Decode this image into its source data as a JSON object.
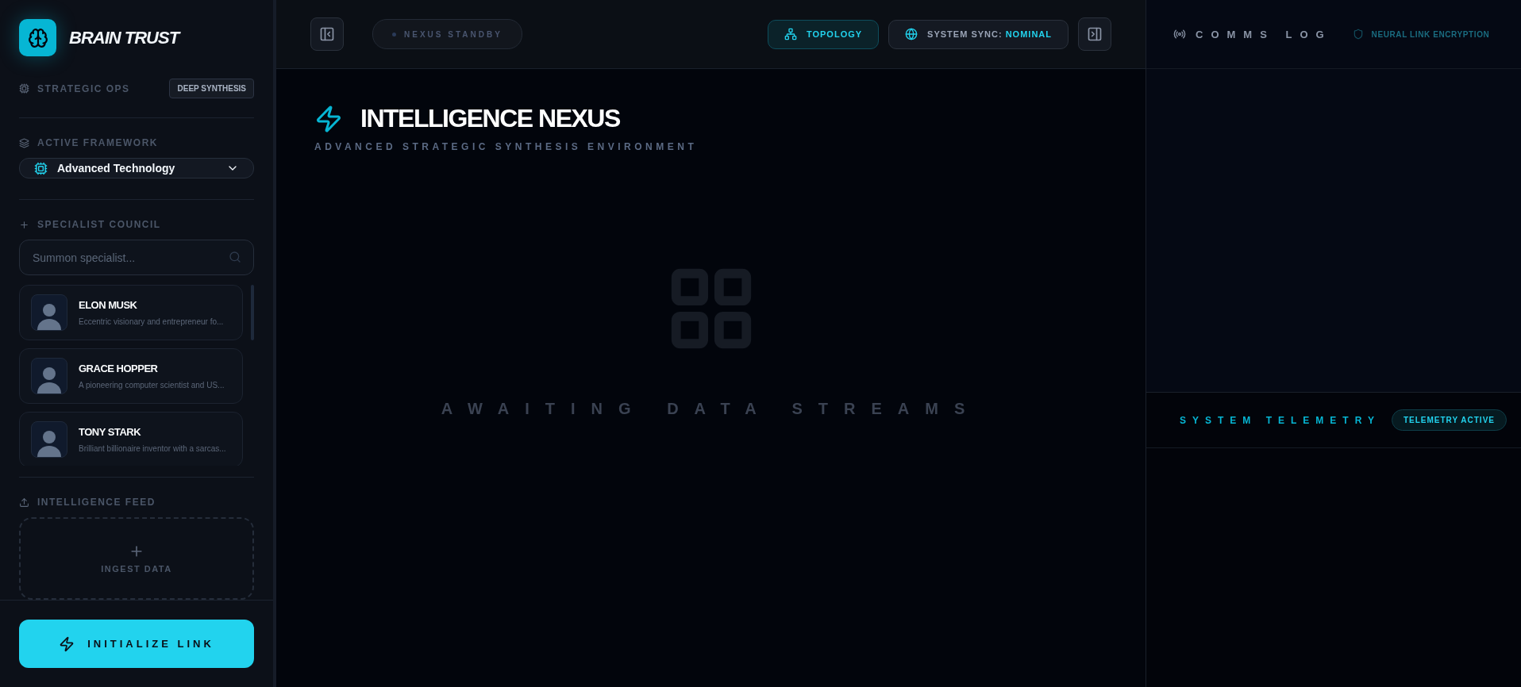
{
  "brand": {
    "name": "BRAIN TRUST"
  },
  "sidebar": {
    "ops": {
      "label": "STRATEGIC OPS",
      "badge": "DEEP SYNTHESIS"
    },
    "framework": {
      "label": "ACTIVE FRAMEWORK",
      "value": "Advanced Technology"
    },
    "council": {
      "label": "SPECIALIST COUNCIL",
      "search_placeholder": "Summon specialist...",
      "specialists": [
        {
          "name": "ELON MUSK",
          "description": "Eccentric visionary and entrepreneur fo...",
          "selected": false
        },
        {
          "name": "GRACE HOPPER",
          "description": "A pioneering computer scientist and US...",
          "selected": false
        },
        {
          "name": "TONY STARK",
          "description": "Brilliant billionaire inventor with a sarcas...",
          "selected": false
        }
      ]
    },
    "feed": {
      "label": "INTELLIGENCE FEED",
      "dropzone": "INGEST DATA"
    },
    "action": "INITIALIZE LINK"
  },
  "topbar": {
    "status": {
      "label": "NEXUS STANDBY",
      "active": false
    },
    "buttons": [
      {
        "label": "TOPOLOGY",
        "selected": true
      }
    ],
    "sync": {
      "label": "SYSTEM SYNC:",
      "value": "NOMINAL"
    }
  },
  "main": {
    "title": "INTELLIGENCE NEXUS",
    "subtitle": "ADVANCED STRATEGIC SYNTHESIS ENVIRONMENT",
    "empty": "AWAITING DATA STREAMS"
  },
  "comms": {
    "title": "COMMS LOG",
    "encryption": "NEURAL LINK ENCRYPTION"
  },
  "telemetry": {
    "title": "SYSTEM TELEMETRY",
    "badge": "TELEMETRY ACTIVE"
  }
}
